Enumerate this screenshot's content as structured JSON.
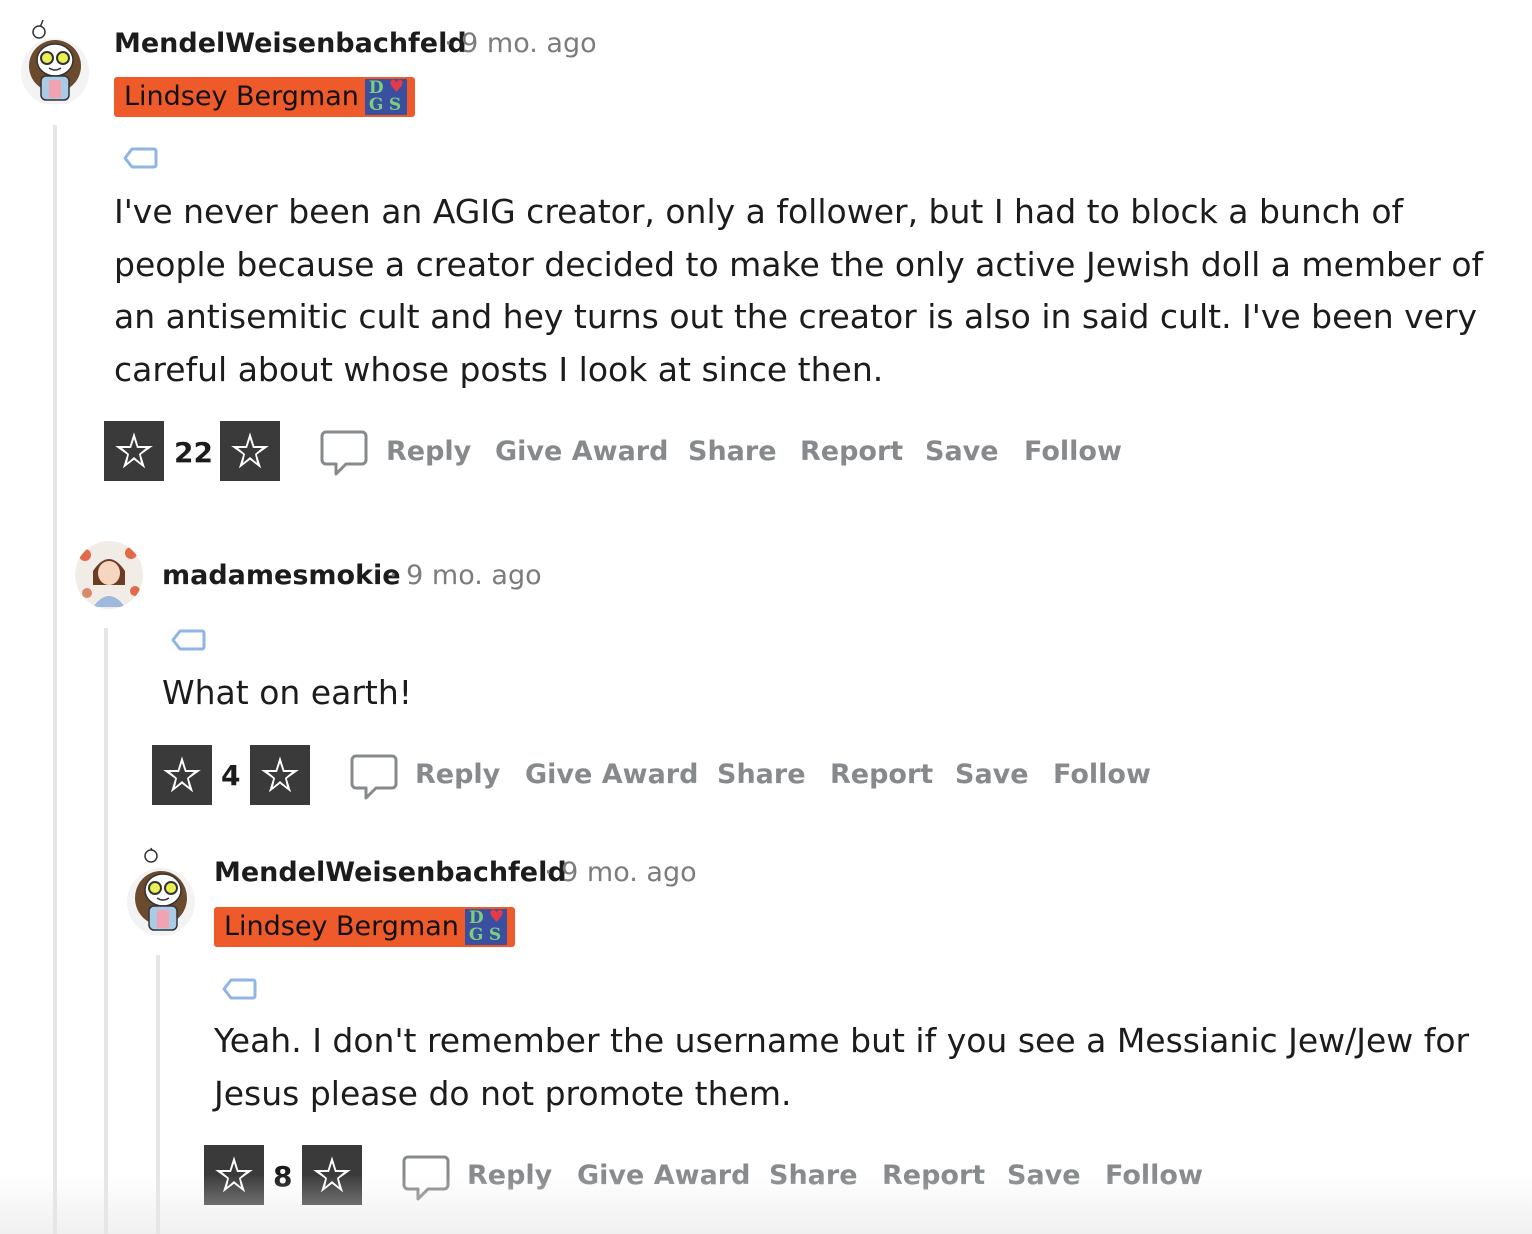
{
  "comments": [
    {
      "username": "MendelWeisenbachfeld",
      "time": "· 9 mo. ago",
      "flair": "Lindsey Bergman",
      "flair_emoji": [
        "D",
        "G",
        "S"
      ],
      "body": "I've never been an AGIG creator, only a follower, but I had to block a bunch of people because a creator decided to make the only active Jewish doll a member of an antisemitic cult and hey turns out the creator is also in said cult. I've been very careful about whose posts I look at since then.",
      "score": "22"
    },
    {
      "username": "madamesmokie",
      "time": "· 9 mo. ago",
      "body": "What on earth!",
      "score": "4"
    },
    {
      "username": "MendelWeisenbachfeld",
      "time": "· 9 mo. ago",
      "flair": "Lindsey Bergman",
      "flair_emoji": [
        "D",
        "G",
        "S"
      ],
      "body": "Yeah. I don't remember the username but if you see a Messianic Jew/Jew for Jesus please do not promote them.",
      "score": "8"
    }
  ],
  "actions": {
    "reply": "Reply",
    "give_award": "Give Award",
    "share": "Share",
    "report": "Report",
    "save": "Save",
    "follow": "Follow"
  },
  "colors": {
    "flair_bg": "#ee5a2a",
    "action_text": "#878a8c",
    "thread_line": "#e4e6e8",
    "vote_bg": "#3a3a3a",
    "tag_icon": "#8fb4e6"
  },
  "icons": {
    "upvote": "upvote-star-icon",
    "downvote": "downvote-star-icon",
    "comment": "speech-bubble-icon",
    "tag": "tag-icon"
  }
}
